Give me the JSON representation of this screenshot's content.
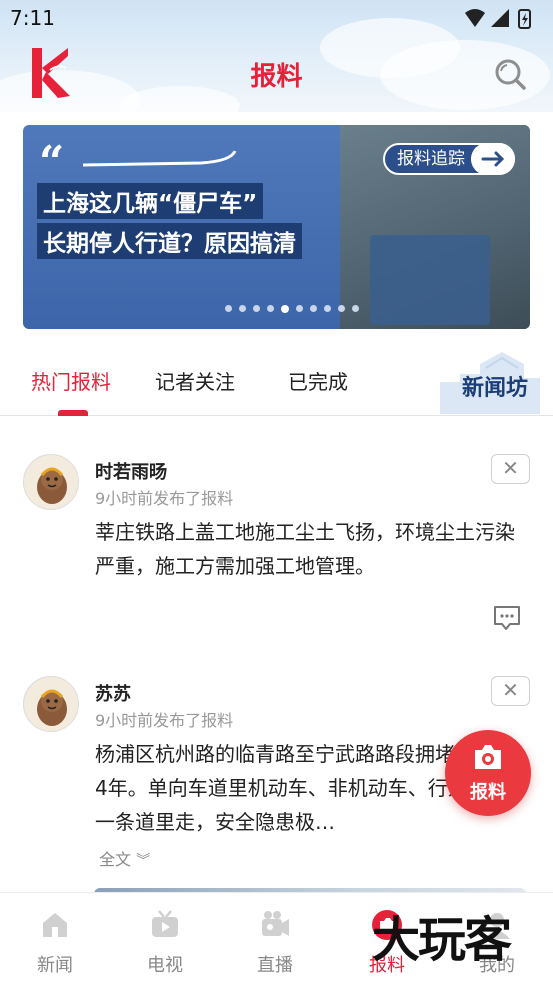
{
  "status_bar": {
    "time": "7:11"
  },
  "header": {
    "title": "报料",
    "brand_color": "#e6213a"
  },
  "banner": {
    "tag": "报料追踪",
    "headline_1": "上海这几辆“僵尸车”",
    "headline_2": "长期停人行道？原因搞清",
    "dot_count": 10,
    "active_dot": 5
  },
  "tabs": [
    {
      "label": "热门报料",
      "active": true
    },
    {
      "label": "记者关注",
      "active": false
    },
    {
      "label": "已完成",
      "active": false
    }
  ],
  "tab_decoration": "新闻坊",
  "posts": [
    {
      "author": "时若雨旸",
      "time": "9小时前发布了报料",
      "text": "莘庄铁路上盖工地施工尘土飞扬，环境尘土污染严重，施工方需加强工地管理。"
    },
    {
      "author": "苏苏",
      "time": "9小时前发布了报料",
      "text": "杨浦区杭州路的临青路至宁武路路段拥堵，长达4年。单向车道里机动车、非机动车、行人混在一条道里走，安全隐患极…",
      "expand_label": "全文"
    }
  ],
  "fab": {
    "label": "报料"
  },
  "bottom_nav": [
    {
      "label": "新闻",
      "icon": "home-icon",
      "active": false
    },
    {
      "label": "电视",
      "icon": "tv-icon",
      "active": false
    },
    {
      "label": "直播",
      "icon": "camera-icon",
      "active": false
    },
    {
      "label": "报料",
      "icon": "report-icon",
      "active": true
    },
    {
      "label": "我的",
      "icon": "profile-icon",
      "active": false
    }
  ],
  "watermark": "大玩客"
}
